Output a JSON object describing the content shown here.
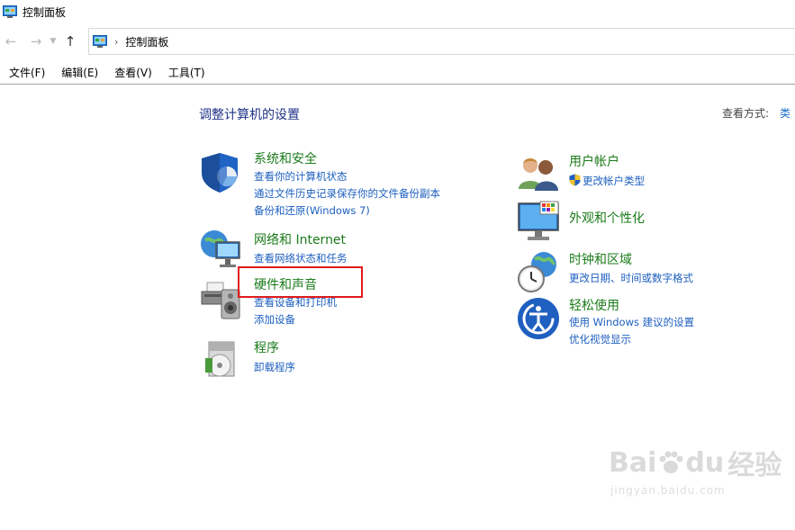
{
  "window": {
    "title": "控制面板"
  },
  "address": {
    "crumb": "控制面板"
  },
  "menu": [
    "文件(F)",
    "编辑(E)",
    "查看(V)",
    "工具(T)"
  ],
  "heading": "调整计算机的设置",
  "view_by": {
    "label": "查看方式:",
    "value": "类"
  },
  "categories": {
    "system": {
      "title": "系统和安全",
      "links": [
        "查看你的计算机状态",
        "通过文件历史记录保存你的文件备份副本",
        "备份和还原(Windows 7)"
      ]
    },
    "network": {
      "title": "网络和 Internet",
      "links": [
        "查看网络状态和任务"
      ]
    },
    "hardware": {
      "title": "硬件和声音",
      "links": [
        "查看设备和打印机",
        "添加设备"
      ]
    },
    "programs": {
      "title": "程序",
      "links": [
        "卸载程序"
      ]
    },
    "users": {
      "title": "用户帐户",
      "links": [
        "更改帐户类型"
      ]
    },
    "appearance": {
      "title": "外观和个性化",
      "links": []
    },
    "clock": {
      "title": "时钟和区域",
      "links": [
        "更改日期、时间或数字格式"
      ]
    },
    "ease": {
      "title": "轻松使用",
      "links": [
        "使用 Windows 建议的设置",
        "优化视觉显示"
      ]
    }
  },
  "watermark": {
    "brand": "Bai",
    "brand2": "du",
    "text": "经验",
    "url": "jingyan.baidu.com"
  }
}
